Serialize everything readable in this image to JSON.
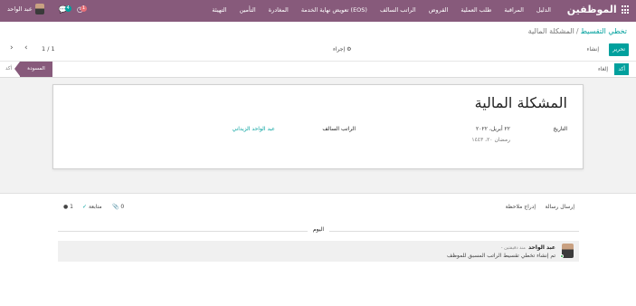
{
  "navbar": {
    "brand": "الموظفين",
    "menu": [
      "الدليل",
      "المراقبة",
      "طلب العملية",
      "القروض",
      "الراتب السالف",
      "تعويض نهاية الخدمة (EOS)",
      "المغادرة",
      "التأمين",
      "التهيئة"
    ],
    "user_name": "عبد الواحد",
    "activity_count": "4",
    "message_count": "1"
  },
  "breadcrumb": {
    "parent": "تخطي التقسيط",
    "separator": "/",
    "current": "المشكلة المالية"
  },
  "toolbar": {
    "edit_label": "تحرير",
    "create_label": "إنشاء",
    "action_label": "إجراء",
    "pager_value": "1 / 1"
  },
  "statusbar": {
    "confirm_label": "أكد",
    "cancel_label": "إلغاء",
    "stage_active": "المسودة",
    "stage_next": "أكد"
  },
  "record": {
    "title": "المشكلة المالية",
    "date_label": "التاريخ",
    "date_value": "٢٢ أبريل، ٢٠٢٢",
    "hijri_value": "رمضان ٢٠، ١٤٤٣",
    "salary_label": "الراتب السالف",
    "salary_value": "عبد الواحد الزيداني"
  },
  "chatter": {
    "send_message": "إرسال رسالة",
    "log_note": "إدراج ملاحظة",
    "attachments": "0",
    "follow_label": "متابعة",
    "followers": "1",
    "day_label": "اليوم",
    "author": "عبد الواحد",
    "time": "- منذ دقيقتين",
    "body": "تم إنشاء تخطي تقسيط الراتب المسبق للموظف"
  },
  "colors": {
    "brand": "#875a7b",
    "accent": "#00a09d"
  }
}
